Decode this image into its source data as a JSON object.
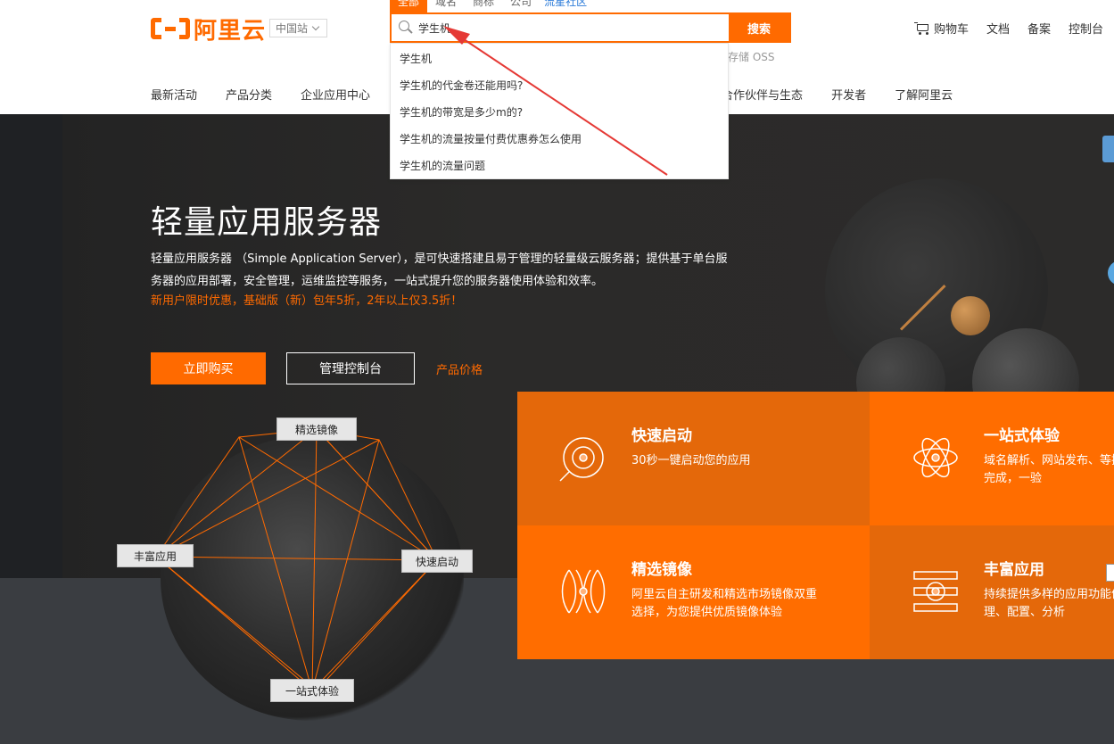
{
  "header": {
    "logo_text": "阿里云",
    "site_select": "中国站",
    "search_tabs": [
      "全部",
      "域名",
      "商标",
      "公司",
      "流星社区"
    ],
    "search_query": "学生机",
    "search_button": "搜索",
    "hot_keyword": "存储 OSS",
    "suggestions": [
      "学生机",
      "学生机的代金卷还能用吗?",
      "学生机的带宽是多少m的?",
      "学生机的流量按量付费优惠券怎么使用",
      "学生机的流量问题"
    ],
    "cart": "购物车",
    "docs": "文档",
    "beian": "备案",
    "console": "控制台"
  },
  "nav": {
    "items": [
      "最新活动",
      "产品分类",
      "企业应用中心",
      "合作伙伴与生态",
      "开发者",
      "了解阿里云"
    ]
  },
  "hero": {
    "title": "轻量应用服务器",
    "description": "轻量应用服务器 （Simple Application Server），是可快速搭建且易于管理的轻量级云服务器；提供基于单台服务器的应用部署，安全管理，运维监控等服务，一站式提升您的服务器使用体验和效率。",
    "promo": "新用户限时优惠，基础版（新）包年5折，2年以上仅3.5折！",
    "buy_button": "立即购买",
    "console_button": "管理控制台",
    "price_link": "产品价格"
  },
  "diagram": {
    "labels": [
      "精选镜像",
      "丰富应用",
      "快速启动",
      "一站式体验"
    ]
  },
  "features": [
    {
      "title": "快速启动",
      "desc": "30秒一键启动您的应用",
      "icon": "target-icon"
    },
    {
      "title": "一站式体验",
      "desc": "域名解析、网站发布、等操作单界面完成，一验",
      "icon": "atom-icon"
    },
    {
      "title": "精选镜像",
      "desc": "阿里云自主研发和精选市场镜像双重选择，为您提供优质镜像体验",
      "icon": "mirror-icon"
    },
    {
      "title": "丰富应用",
      "desc": "持续提供多样的应用功能便捷地管理、配置、分析",
      "icon": "layers-icon"
    }
  ],
  "colors": {
    "brand": "#ff6a00",
    "hero_bg": "#2a2a2b",
    "annotation_arrow": "#e53935"
  }
}
